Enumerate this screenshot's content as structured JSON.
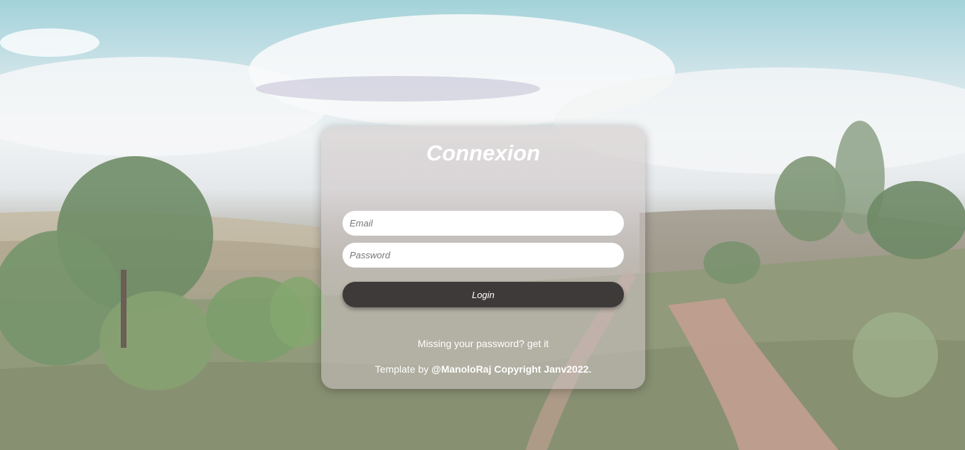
{
  "login_card": {
    "title": "Connexion",
    "email_placeholder": "Email",
    "password_placeholder": "Password",
    "login_label": "Login",
    "missing_password_text": "Missing your password? get it",
    "footer_prefix": "Template by ",
    "footer_author": "@ManoloRaj Copyright Janv2022."
  },
  "colors": {
    "button_bg": "#3d3a39",
    "card_bg": "rgba(205,196,196,0.55)",
    "text": "#ffffff"
  }
}
